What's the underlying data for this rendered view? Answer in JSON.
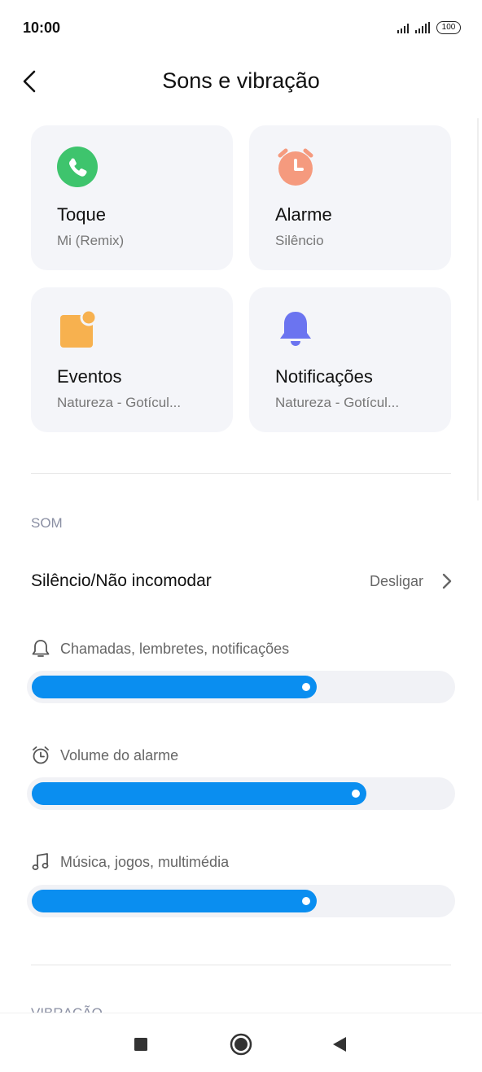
{
  "status_bar": {
    "time": "10:00",
    "battery": "100"
  },
  "header": {
    "title": "Sons e vibração"
  },
  "cards": {
    "ringtone": {
      "title": "Toque",
      "subtitle": "Mi (Remix)"
    },
    "alarm": {
      "title": "Alarme",
      "subtitle": "Silêncio"
    },
    "events": {
      "title": "Eventos",
      "subtitle": "Natureza - Gotícul..."
    },
    "notifications": {
      "title": "Notificações",
      "subtitle": "Natureza - Gotícul..."
    }
  },
  "sound_section": {
    "label": "SOM",
    "dnd": {
      "label": "Silêncio/Não incomodar",
      "value": "Desligar"
    },
    "volumes": [
      {
        "label": "Chamadas, lembretes, notificações",
        "icon": "bell-outline-icon",
        "level": 0.68
      },
      {
        "label": "Volume do alarme",
        "icon": "alarm-clock-outline-icon",
        "level": 0.8
      },
      {
        "label": "Música, jogos, multimédia",
        "icon": "music-note-icon",
        "level": 0.68
      }
    ]
  },
  "vibration_section": {
    "label": "VIBRAÇÃO"
  },
  "colors": {
    "accent": "#0a8ef0",
    "phone_icon": "#3ec46d",
    "alarm_icon": "#f59a7e",
    "events_icon": "#f7b14f",
    "bell_icon": "#6b74f0"
  }
}
